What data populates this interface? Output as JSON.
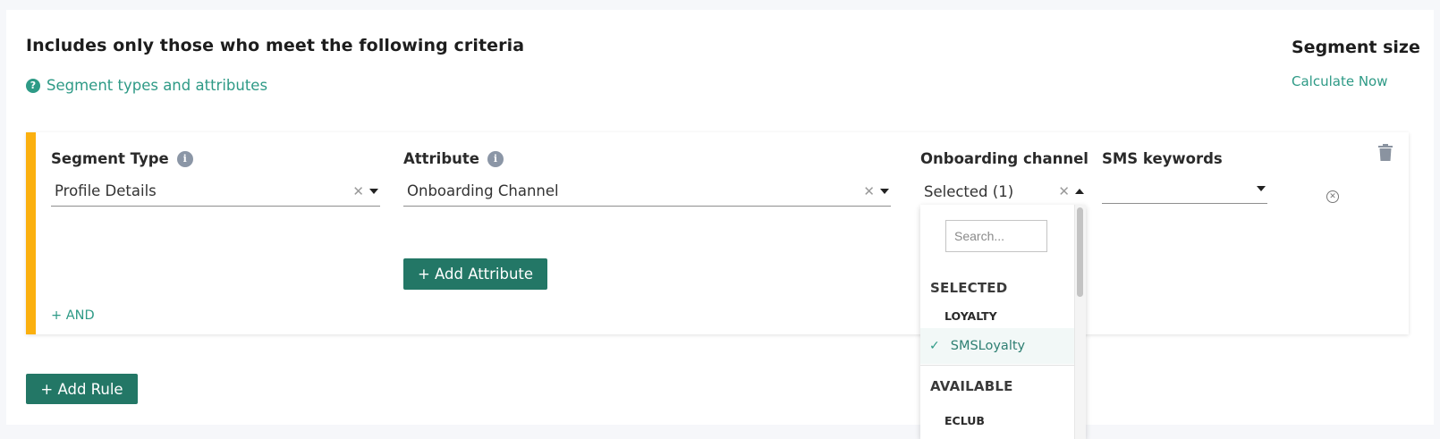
{
  "header": {
    "title": "Includes only those who meet the following criteria",
    "help_link": "Segment types and attributes",
    "segment_size_title": "Segment size",
    "calculate_link": "Calculate Now"
  },
  "rule": {
    "segment_type": {
      "label": "Segment Type",
      "value": "Profile Details"
    },
    "attribute": {
      "label": "Attribute",
      "value": "Onboarding Channel"
    },
    "onboarding_channel": {
      "label": "Onboarding channel",
      "value": "Selected (1)"
    },
    "sms_keywords": {
      "label": "SMS keywords",
      "value": ""
    },
    "add_attribute_label": "+ Add Attribute",
    "and_label": "+ AND"
  },
  "dropdown": {
    "search_placeholder": "Search...",
    "selected_header": "SELECTED",
    "selected_group": "LOYALTY",
    "selected_item": "SMSLoyalty",
    "available_header": "AVAILABLE",
    "available_group": "ECLUB"
  },
  "footer": {
    "add_rule_label": "+ Add Rule"
  },
  "icons": {
    "help": "question-circle",
    "info": "info-circle",
    "trash": "trash",
    "remove": "x-circle",
    "check": "checkmark"
  },
  "colors": {
    "accent": "#2e9a86",
    "button": "#237766",
    "rule_bar": "#fbb00f"
  }
}
